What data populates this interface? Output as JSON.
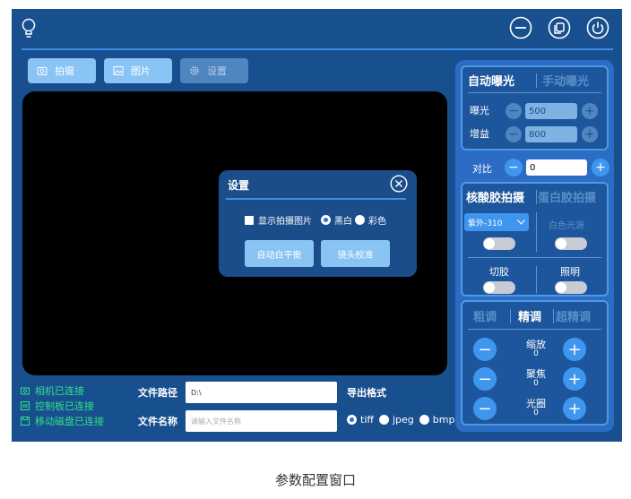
{
  "tabs": [
    {
      "label": "拍摄",
      "icon": "camera-icon"
    },
    {
      "label": "图片",
      "icon": "image-icon"
    },
    {
      "label": "设置",
      "icon": "gear-icon"
    }
  ],
  "dialog": {
    "title": "设置",
    "show_image_label": "显示拍摄图片",
    "mono_label": "黑白",
    "color_label": "彩色",
    "awb_button": "自动白平衡",
    "lens_button": "镜头校准"
  },
  "status": {
    "camera": "相机已连接",
    "board": "控制板已连接",
    "disk": "移动磁盘已连接"
  },
  "file": {
    "path_label": "文件路径",
    "path_value": "D:\\",
    "name_label": "文件名称",
    "name_placeholder": "请输入文件名称"
  },
  "export": {
    "label": "导出格式",
    "formats": [
      "tiff",
      "jpeg",
      "bmp"
    ],
    "selected": "tiff"
  },
  "exposure": {
    "auto_tab": "自动曝光",
    "manual_tab": "手动曝光",
    "exposure_label": "曝光",
    "exposure_value": "500",
    "gain_label": "增益",
    "gain_value": "800",
    "contrast_label": "对比",
    "contrast_value": "0"
  },
  "capture": {
    "nucleic_tab": "核酸胶拍摄",
    "protein_tab": "蛋白胶拍摄",
    "uv_select": "紫外-310",
    "white_light": "白色光源",
    "cut_label": "切胶",
    "light_label": "照明"
  },
  "adjust": {
    "coarse_tab": "粗调",
    "fine_tab": "精调",
    "ultra_tab": "超精调",
    "zoom_label": "缩放",
    "zoom_value": "0",
    "focus_label": "聚焦",
    "focus_value": "0",
    "aperture_label": "光圈",
    "aperture_value": "0"
  },
  "caption": "参数配置窗口",
  "colors": {
    "background": "#184f8e",
    "accent": "#3f96ef",
    "status_green": "#32e08a"
  }
}
